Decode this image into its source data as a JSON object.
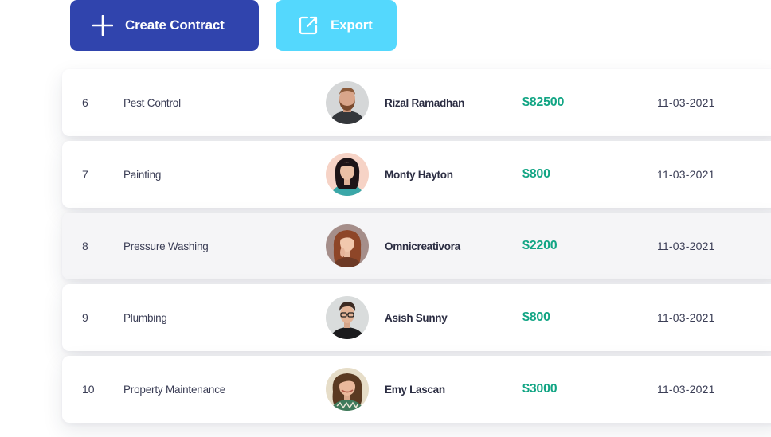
{
  "toolbar": {
    "create_label": "Create Contract",
    "export_label": "Export"
  },
  "colors": {
    "primary": "#3044ad",
    "secondary": "#54d8fd",
    "amount": "#12a584"
  },
  "contracts": [
    {
      "id": "6",
      "service": "Pest Control",
      "name": "Rizal Ramadhan",
      "amount": "$82500",
      "date": "11-03-2021"
    },
    {
      "id": "7",
      "service": "Painting",
      "name": "Monty Hayton",
      "amount": "$800",
      "date": "11-03-2021"
    },
    {
      "id": "8",
      "service": "Pressure Washing",
      "name": "Omnicreativora",
      "amount": "$2200",
      "date": "11-03-2021"
    },
    {
      "id": "9",
      "service": "Plumbing",
      "name": "Asish Sunny",
      "amount": "$800",
      "date": "11-03-2021"
    },
    {
      "id": "10",
      "service": "Property Maintenance",
      "name": "Emy Lascan",
      "amount": "$3000",
      "date": "11-03-2021"
    }
  ]
}
